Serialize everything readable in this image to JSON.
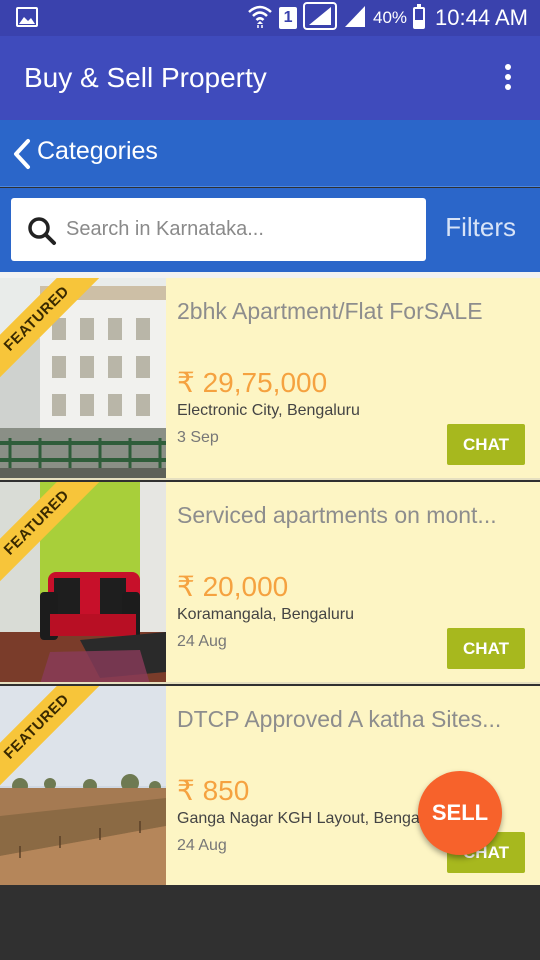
{
  "status_bar": {
    "sim_slot": "1",
    "battery": "40%",
    "battery_level": 0.4,
    "time": "10:44 AM",
    "icons": [
      "gallery-icon",
      "wifi-icon",
      "signal-icon",
      "battery-icon"
    ]
  },
  "app_bar": {
    "title": "Buy & Sell Property",
    "menu_icon": "more-vert-icon"
  },
  "categories": {
    "label": "Categories",
    "back_icon": "chevron-left-icon"
  },
  "search": {
    "placeholder": "Search in Karnataka...",
    "value": "",
    "filters_label": "Filters"
  },
  "listings": [
    {
      "badge": "FEATURED",
      "title": "2bhk Apartment/Flat ForSALE",
      "price": "₹ 29,75,000",
      "location": "Electronic City, Bengaluru",
      "date": "3 Sep",
      "chat_label": "CHAT"
    },
    {
      "badge": "FEATURED",
      "title": "Serviced apartments on mont...",
      "price": "₹ 20,000",
      "location": "Koramangala, Bengaluru",
      "date": "24 Aug",
      "chat_label": "CHAT"
    },
    {
      "badge": "FEATURED",
      "title": "DTCP Approved A katha Sites...",
      "price": "₹ 850",
      "location": "Ganga Nagar KGH Layout, Benga",
      "date": "24 Aug",
      "chat_label": "CHAT"
    }
  ],
  "fab": {
    "label": "SELL"
  },
  "colors": {
    "status_bar": "#3a42ad",
    "app_bar": "#3f4bbc",
    "search_area": "#2b66c9",
    "listing_bg": "#fdf5c4",
    "price": "#f5a240",
    "chat_button": "#a7b81e",
    "fab": "#f7622b",
    "ribbon": "#f7c53a"
  }
}
